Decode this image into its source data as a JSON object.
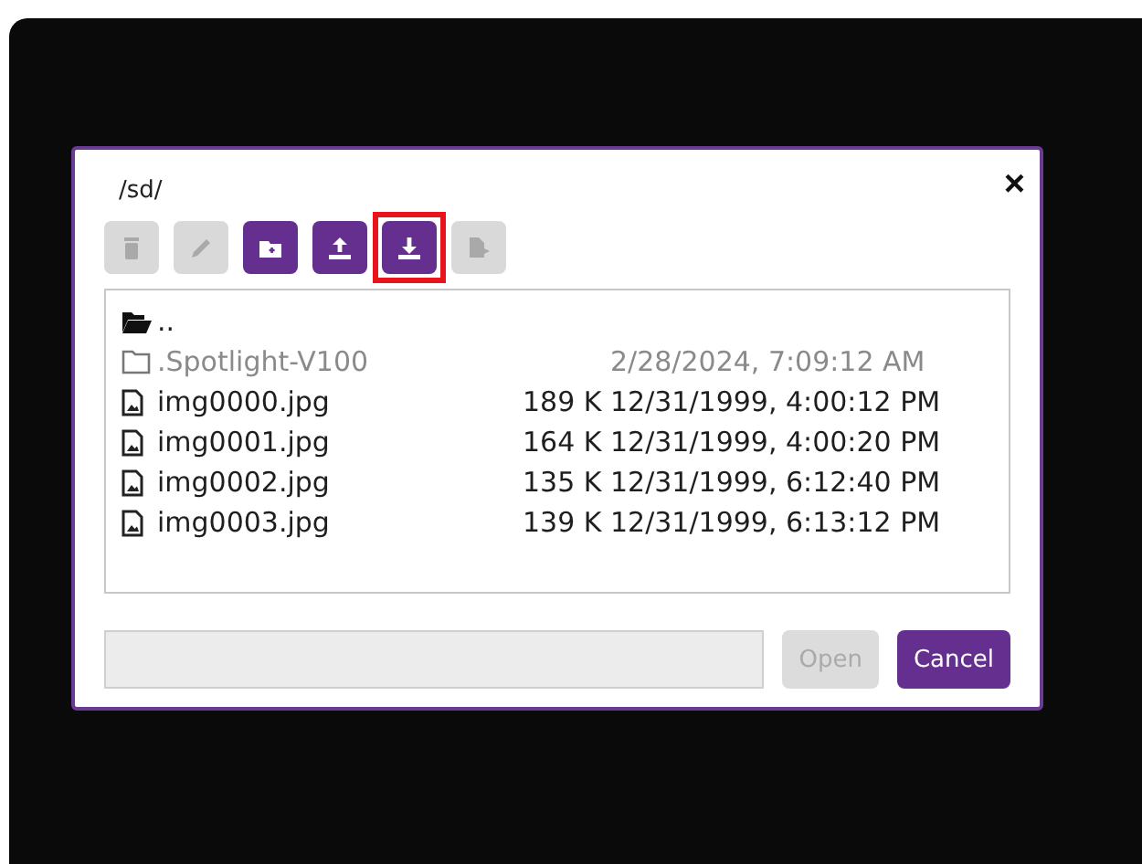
{
  "dialog": {
    "path": "/sd/",
    "close": "×",
    "toolbar": [
      {
        "kind": "delete",
        "disabled": true,
        "highlighted": false
      },
      {
        "kind": "rename",
        "disabled": true,
        "highlighted": false
      },
      {
        "kind": "new-folder",
        "disabled": false,
        "highlighted": false
      },
      {
        "kind": "upload",
        "disabled": false,
        "highlighted": false
      },
      {
        "kind": "download",
        "disabled": false,
        "highlighted": true
      },
      {
        "kind": "move",
        "disabled": true,
        "highlighted": false
      }
    ],
    "files": [
      {
        "kind": "parent",
        "name": "..",
        "hidden": false
      },
      {
        "kind": "folder",
        "name": ".Spotlight-V100",
        "date": "2/28/2024, 7:09:12 AM",
        "hidden": true
      },
      {
        "kind": "file",
        "name": "img0000.jpg",
        "size": "189 K",
        "date": "12/31/1999, 4:00:12 PM",
        "hidden": false
      },
      {
        "kind": "file",
        "name": "img0001.jpg",
        "size": "164 K",
        "date": "12/31/1999, 4:00:20 PM",
        "hidden": false
      },
      {
        "kind": "file",
        "name": "img0002.jpg",
        "size": "135 K",
        "date": "12/31/1999, 6:12:40 PM",
        "hidden": false
      },
      {
        "kind": "file",
        "name": "img0003.jpg",
        "size": "139 K",
        "date": "12/31/1999, 6:13:12 PM",
        "hidden": false
      }
    ],
    "buttons": [
      {
        "label": "Open",
        "disabled": true
      },
      {
        "label": "Cancel",
        "disabled": false
      }
    ]
  }
}
